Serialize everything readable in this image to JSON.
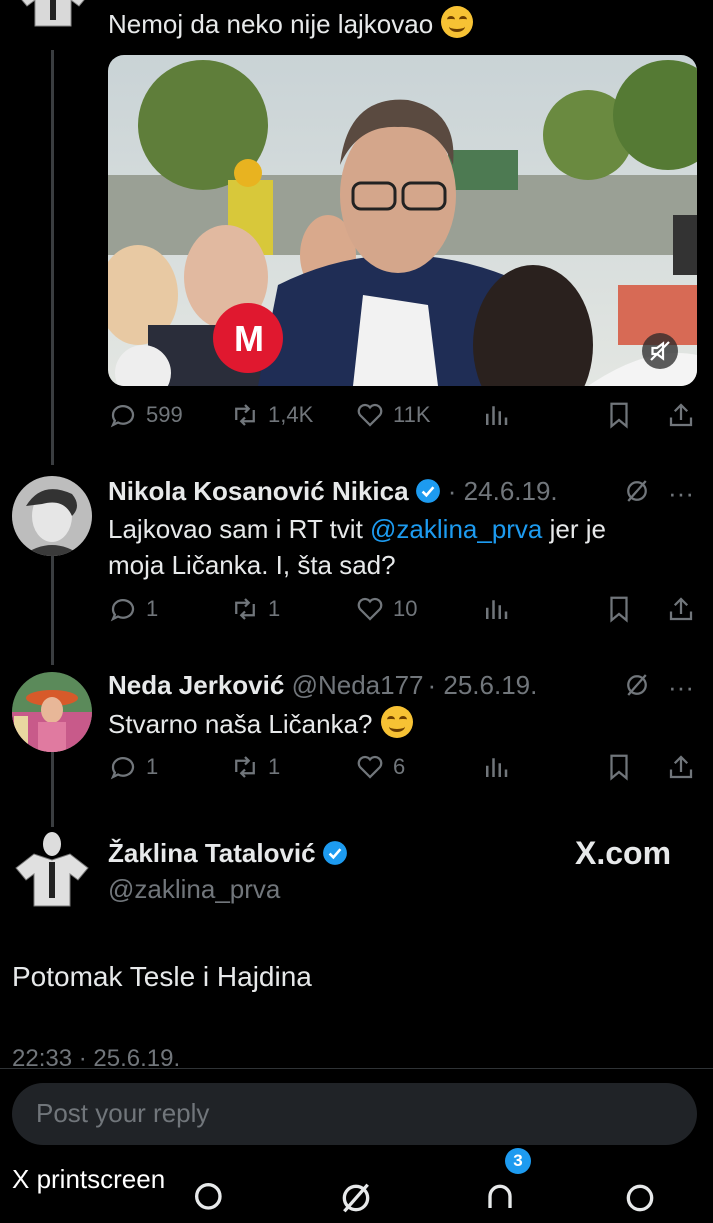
{
  "tweet_main": {
    "text": "Nemoj da neko nije lajkovao",
    "stats": {
      "replies": "599",
      "reposts": "1,4K",
      "likes": "11K"
    }
  },
  "replies": [
    {
      "name": "Nikola Kosanović Nikica",
      "handle": "",
      "date": "· 24.6.19.",
      "text_line1_a": "Lajkovao sam i RT tvit ",
      "text_mention": "@zaklina_prva",
      "text_line1_b": " jer je",
      "text_line2": "moja Ličanka. I, šta sad?",
      "stats": {
        "replies": "1",
        "reposts": "1",
        "likes": "10"
      }
    },
    {
      "name": "Neda Jerković",
      "handle": "@Neda177",
      "date": "· 25.6.19.",
      "text": "Stvarno naša Ličanka?",
      "stats": {
        "replies": "1",
        "reposts": "1",
        "likes": "6"
      }
    }
  ],
  "focus_tweet": {
    "name": "Žaklina Tatalović",
    "handle": "@zaklina_prva",
    "brand": "X.com",
    "text": "Potomak Tesle i Hajdina",
    "timestamp": "22:33 · 25.6.19."
  },
  "reply_box": {
    "placeholder": "Post your reply"
  },
  "bottom_nav": {
    "notification_count": "3"
  },
  "overlay_label": "X printscreen",
  "colors": {
    "accent": "#1d9bf0",
    "muted": "#71767b",
    "text": "#e7e9ea",
    "background": "#000000"
  },
  "icons": [
    "reply-icon",
    "repost-icon",
    "like-icon",
    "views-icon",
    "bookmark-icon",
    "share-icon",
    "verified-icon",
    "grok-icon",
    "more-icon",
    "mute-icon"
  ]
}
